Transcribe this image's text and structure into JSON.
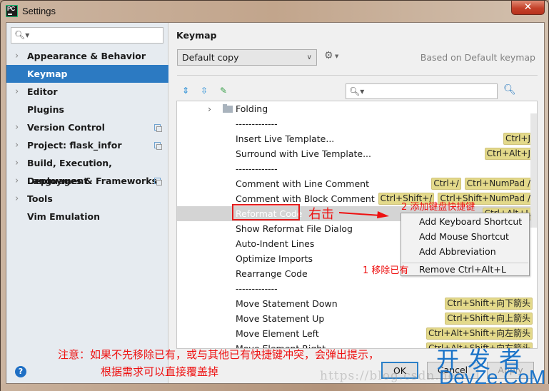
{
  "window": {
    "title": "Settings",
    "app_icon": "PC"
  },
  "sidebar": {
    "search_placeholder": "",
    "items": [
      {
        "label": "Appearance & Behavior",
        "expandable": true,
        "project_icon": false
      },
      {
        "label": "Keymap",
        "expandable": false,
        "selected": true,
        "project_icon": false
      },
      {
        "label": "Editor",
        "expandable": true,
        "project_icon": false
      },
      {
        "label": "Plugins",
        "expandable": false,
        "project_icon": false
      },
      {
        "label": "Version Control",
        "expandable": true,
        "project_icon": true
      },
      {
        "label": "Project: flask_infor",
        "expandable": true,
        "project_icon": true
      },
      {
        "label": "Build, Execution, Deployment",
        "expandable": true,
        "project_icon": false
      },
      {
        "label": "Languages & Frameworks",
        "expandable": true,
        "project_icon": true
      },
      {
        "label": "Tools",
        "expandable": true,
        "project_icon": false
      },
      {
        "label": "Vim Emulation",
        "expandable": false,
        "project_icon": false
      }
    ]
  },
  "panel": {
    "title": "Keymap",
    "keymap_selected": "Default copy",
    "based_on": "Based on Default keymap",
    "search_placeholder": ""
  },
  "tree": {
    "rows": [
      {
        "label": "Folding",
        "type": "folder",
        "keys": []
      },
      {
        "label": "-------------",
        "keys": []
      },
      {
        "label": "Insert Live Template...",
        "keys": [
          "Ctrl+J"
        ]
      },
      {
        "label": "Surround with Live Template...",
        "keys": [
          "Ctrl+Alt+J"
        ]
      },
      {
        "label": "-------------",
        "keys": []
      },
      {
        "label": "Comment with Line Comment",
        "keys": [
          "Ctrl+/",
          "Ctrl+NumPad /"
        ]
      },
      {
        "label": "Comment with Block Comment",
        "keys": [
          "Ctrl+Shift+/",
          "Ctrl+Shift+NumPad /"
        ]
      },
      {
        "label": "Reformat Code",
        "keys": [
          "Ctrl+Alt+L"
        ],
        "highlighted": true
      },
      {
        "label": "Show Reformat File Dialog",
        "keys": []
      },
      {
        "label": "Auto-Indent Lines",
        "keys": []
      },
      {
        "label": "Optimize Imports",
        "keys": []
      },
      {
        "label": "Rearrange Code",
        "keys": []
      },
      {
        "label": "-------------",
        "keys": []
      },
      {
        "label": "Move Statement Down",
        "keys": [
          "Ctrl+Shift+向下箭头"
        ]
      },
      {
        "label": "Move Statement Up",
        "keys": [
          "Ctrl+Shift+向上箭头"
        ]
      },
      {
        "label": "Move Element Left",
        "keys": [
          "Ctrl+Alt+Shift+向左箭头"
        ]
      },
      {
        "label": "Move Element Right",
        "keys": [
          "Ctrl+Alt+Shift+向右箭头"
        ]
      }
    ]
  },
  "context_menu": {
    "items": [
      "Add Keyboard Shortcut",
      "Add Mouse Shortcut",
      "Add Abbreviation",
      "Remove Ctrl+Alt+L"
    ]
  },
  "annotations": {
    "right_click": "右击",
    "step2": "2 添加键盘快捷键",
    "step1": "1 移除已有",
    "note_line1": "注意：如果不先移除已有，或与其他已有快捷键冲突，会弹出提示，",
    "note_line2": "根据需求可以直接覆盖掉"
  },
  "footer": {
    "ok": "OK",
    "cancel": "Cancel",
    "apply": "Apply",
    "help": "?"
  },
  "watermark": {
    "url": "https://blog.csdn.net/",
    "cn": "开发者",
    "en": "DevZe.CoM"
  },
  "colors": {
    "selection": "#2c7ac2",
    "shortcut_badge": "#e3d98a",
    "annotation": "#ee1111",
    "watermark": "#1a73c8"
  }
}
